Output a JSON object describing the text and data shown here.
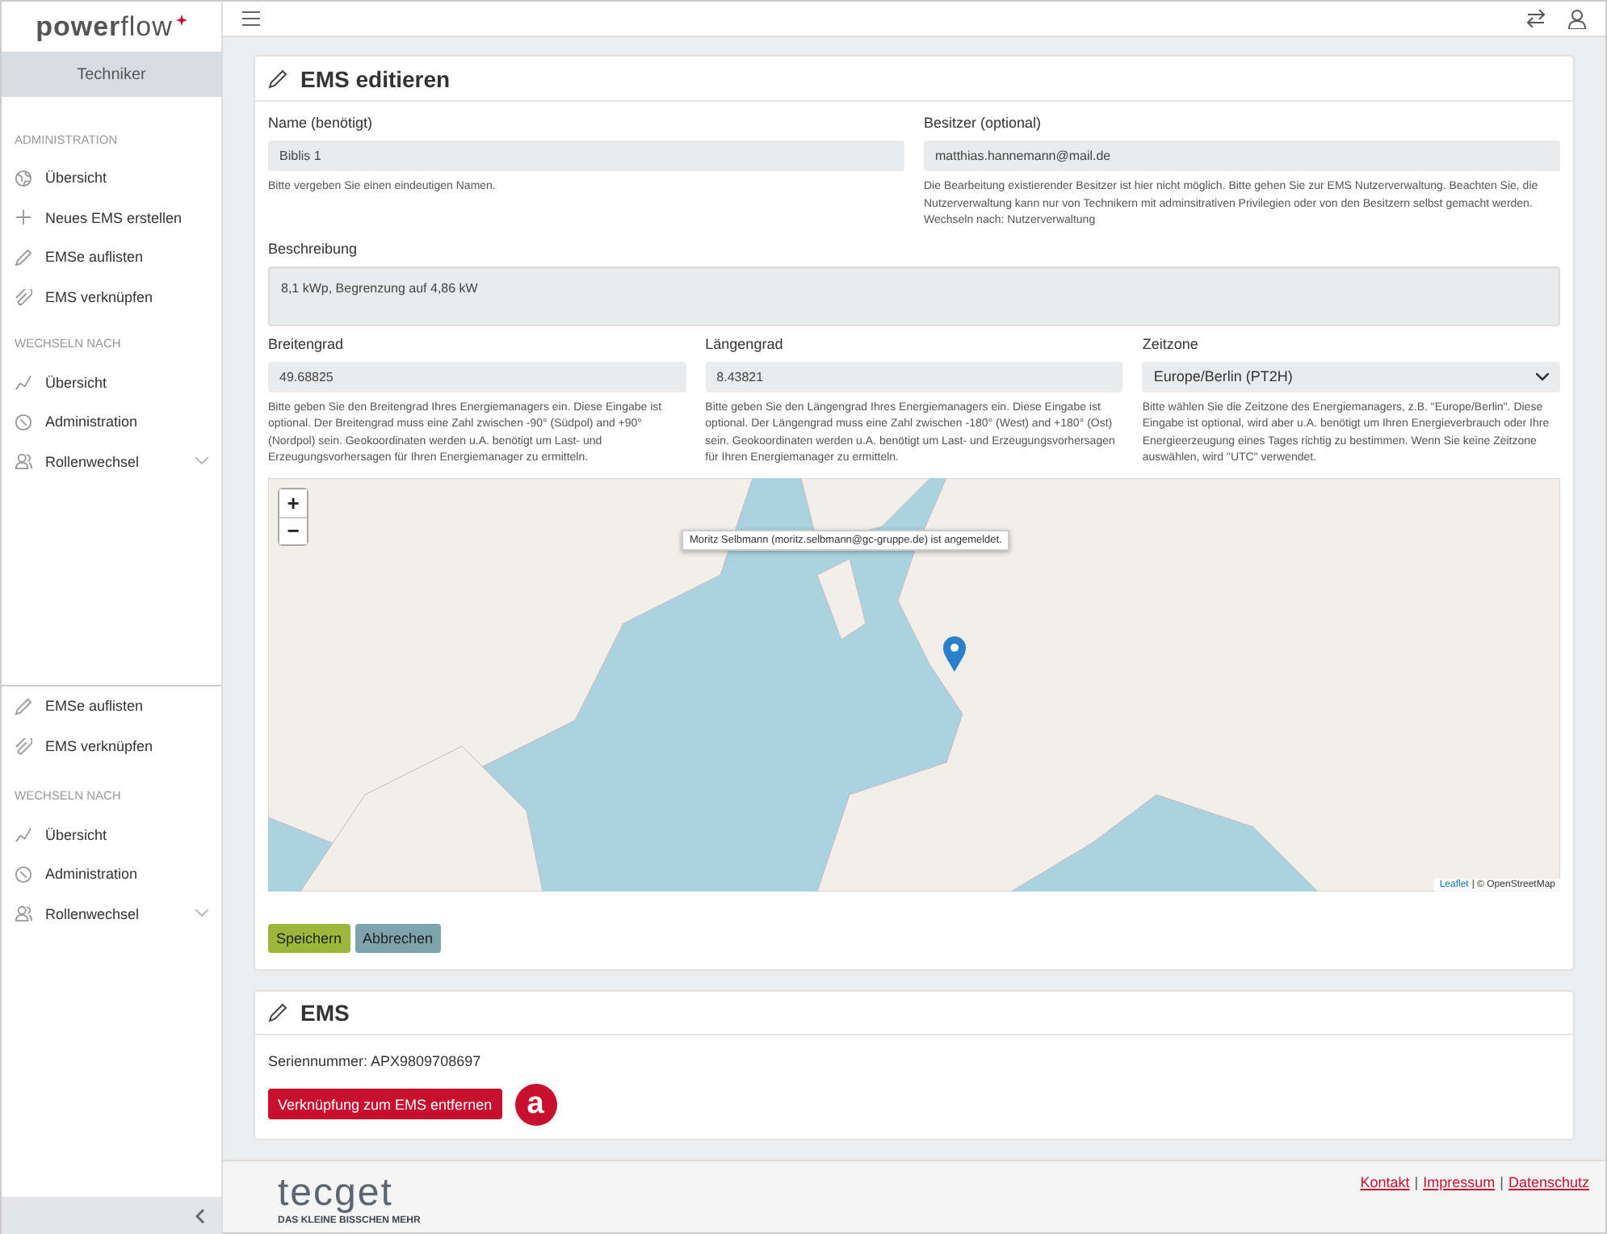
{
  "brand": {
    "name": "**power**flow"
  },
  "sidebar": {
    "role": "Techniker",
    "blocks": [
      {
        "items": [
          {
            "kind": "heading",
            "label": "ADMINISTRATION"
          },
          {
            "kind": "link",
            "label": "Übersicht"
          },
          {
            "kind": "link",
            "label": "Neues EMS erstellen"
          },
          {
            "kind": "link",
            "label": "EMSe auflisten"
          },
          {
            "kind": "link",
            "label": "EMS verknüpfen"
          },
          {
            "kind": "heading",
            "label": "WECHSELN NACH"
          },
          {
            "kind": "link",
            "label": "Übersicht"
          },
          {
            "kind": "link",
            "label": "Administration"
          },
          {
            "kind": "dropdown",
            "label": "Rollenwechsel",
            "expanded": false
          }
        ]
      },
      {
        "items": [
          {
            "kind": "link",
            "label": "EMSe auflisten"
          },
          {
            "kind": "link",
            "label": "EMS verknüpfen"
          },
          {
            "kind": "heading",
            "label": "WECHSELN NACH"
          },
          {
            "kind": "link",
            "label": "Übersicht"
          },
          {
            "kind": "link",
            "label": "Administration"
          },
          {
            "kind": "dropdown",
            "label": "Rollenwechsel",
            "expanded": false
          }
        ]
      }
    ]
  },
  "edit_card": {
    "title": "EMS editieren",
    "rows": [
      [
        {
          "label": "Name (benötigt)",
          "kind": "input",
          "value": "Biblis 1",
          "help": "Bitte vergeben Sie einen eindeutigen Namen."
        },
        {
          "label": "Besitzer (optional)",
          "kind": "input",
          "value": "matthias.hannemann@mail.de",
          "help": "Die Bearbeitung existierender Besitzer ist hier nicht möglich. Bitte gehen Sie zur EMS Nutzerverwaltung. Beachten Sie, die Nutzerverwaltung kann nur von Technikern mit adminsitrativen Privilegien oder von den Besitzern selbst gemacht werden. Wechseln nach: Nutzerverwaltung"
        }
      ],
      [
        {
          "label": "Beschreibung",
          "kind": "textarea",
          "value": "8,1 kWp, Begrenzung auf 4,86 kW"
        }
      ],
      [
        {
          "label": "Breitengrad",
          "kind": "input",
          "value": "49.68825",
          "help": "Bitte geben Sie den Breitengrad Ihres Energiemanagers ein. Diese Eingabe ist optional. Der Breitengrad muss eine Zahl zwischen -90° (Südpol) and +90° (Nordpol) sein. Geokoordinaten werden u.A. benötigt um Last- und Erzeugungsvorhersagen für Ihren Energiemanager zu ermitteln."
        },
        {
          "label": "Längengrad",
          "kind": "input",
          "value": "8.43821",
          "help": "Bitte geben Sie den Längengrad Ihres Energiemanagers ein. Diese Eingabe ist optional. Der Längengrad muss eine Zahl zwischen -180° (West) and +180° (Ost) sein. Geokoordinaten werden u.A. benötigt um Last- und Erzeugungsvorhersagen für Ihren Energiemanager zu ermitteln."
        },
        {
          "label": "Zeitzone",
          "kind": "select",
          "value": "Europe/Berlin (PT2H)",
          "help": "Bitte wählen Sie die Zeitzone des Energiemanagers, z.B. \"Europe/Berlin\". Diese Eingabe ist optional, wird aber u.A. benötigt um Ihren Energieverbrauch oder Ihre Energieerzeugung eines Tages richtig zu bestimmen. Wenn Sie keine Zeitzone auswählen, wird \"UTC\" verwendet."
        }
      ]
    ],
    "map": {
      "zoom_in": "+",
      "zoom_out": "−",
      "attribution_link": "Leaflet",
      "attribution": "| © OpenStreetMap"
    },
    "buttons": [
      {
        "kind": "primary",
        "label": "Speichern"
      },
      {
        "kind": "secondary",
        "label": "Abbrechen"
      }
    ]
  },
  "toast": "Moritz Selbmann (moritz.selbmann@gc-gruppe.de) ist angemeldet.",
  "ems_card": {
    "title": "EMS",
    "serial": "Seriennummer: APX9809708697",
    "button": "Verknüpfung zum EMS entfernen",
    "annotation": "a"
  },
  "footer": {
    "logo": "tecget",
    "tagline": "DAS KLEINE BISSCHEN MEHR",
    "links": [
      "Kontakt",
      "Impressum",
      "Datenschutz"
    ],
    "separators": [
      "|",
      "|"
    ]
  }
}
